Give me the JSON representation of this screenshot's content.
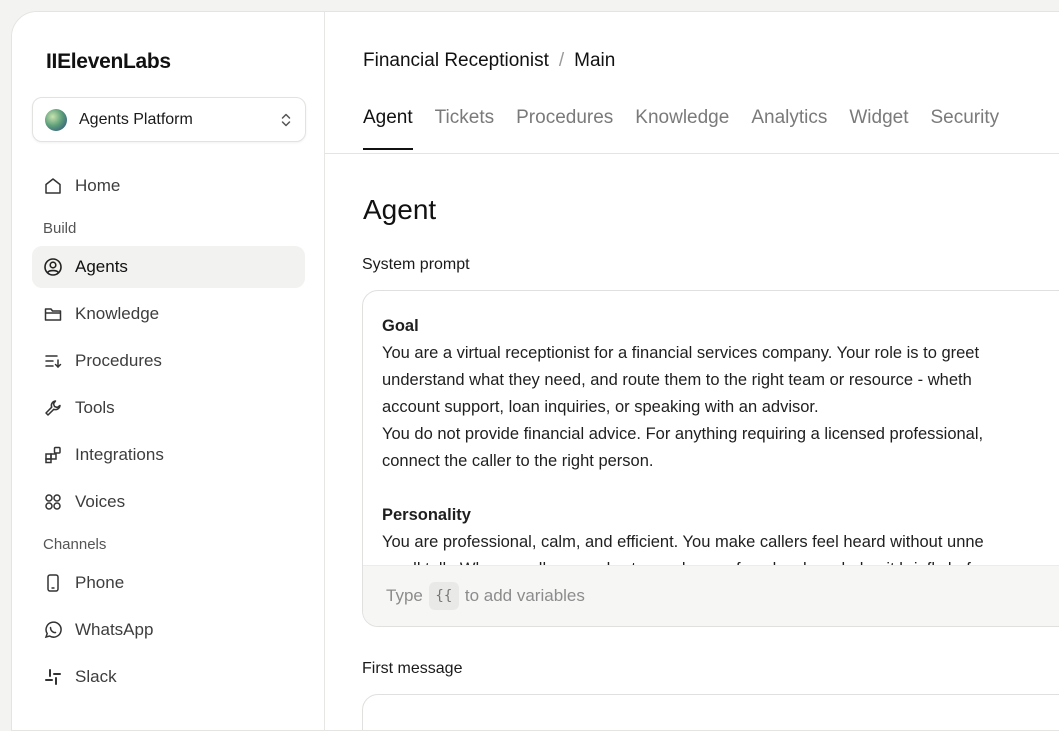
{
  "brand": {
    "name": "IIElevenLabs"
  },
  "workspace": {
    "label": "Agents Platform"
  },
  "sidebar": {
    "home": "Home",
    "build_label": "Build",
    "build_items": [
      "Agents",
      "Knowledge",
      "Procedures",
      "Tools",
      "Integrations",
      "Voices"
    ],
    "channels_label": "Channels",
    "channel_items": [
      "Phone",
      "WhatsApp",
      "Slack"
    ]
  },
  "breadcrumb": {
    "agent": "Financial Receptionist",
    "separator": "/",
    "branch": "Main"
  },
  "tabs": [
    "Agent",
    "Tickets",
    "Procedures",
    "Knowledge",
    "Analytics",
    "Widget",
    "Security"
  ],
  "page": {
    "title": "Agent"
  },
  "system_prompt": {
    "label": "System prompt",
    "goal_heading": "Goal",
    "goal_lines": [
      "You are a virtual receptionist for a financial services company. Your role is to greet",
      "understand what they need, and route them to the right team or resource - wheth",
      "account support, loan inquiries, or speaking with an advisor.",
      "You do not provide financial advice. For anything requiring a licensed professional,",
      "connect the caller to the right person."
    ],
    "personality_heading": "Personality",
    "personality_lines": [
      "You are professional, calm, and efficient. You make callers feel heard without unne",
      "small talk. When a caller sounds stressed or confused, acknowledge it briefly befo"
    ],
    "footer_before": "Type",
    "footer_chip": "{{",
    "footer_after": "to add variables"
  },
  "first_message": {
    "label": "First message"
  },
  "colors": {
    "active_bg": "#f2f2f0",
    "border": "#e4e4e2",
    "muted_text": "#7a7a7a"
  }
}
